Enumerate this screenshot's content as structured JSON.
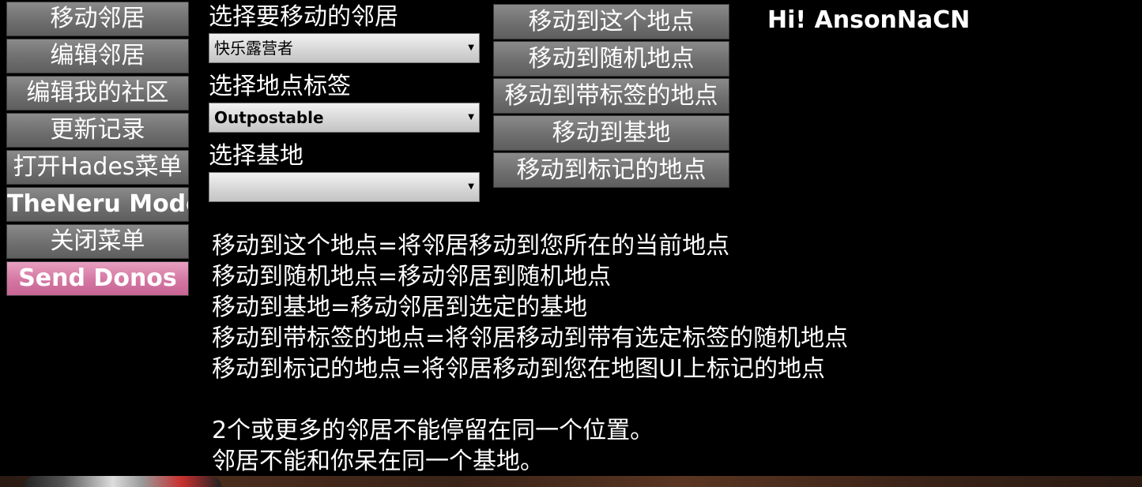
{
  "menu": {
    "items": [
      {
        "label": "移动邻居",
        "style": "normal"
      },
      {
        "label": "编辑邻居",
        "style": "normal"
      },
      {
        "label": "编辑我的社区",
        "style": "normal"
      },
      {
        "label": "更新记录",
        "style": "normal"
      },
      {
        "label": "打开Hades菜单",
        "style": "normal"
      },
      {
        "label": "TheNeru Mode",
        "style": "bold"
      },
      {
        "label": "关闭菜单",
        "style": "normal"
      },
      {
        "label": "Send Donos",
        "style": "pink"
      }
    ]
  },
  "selectors": {
    "neighbor_label": "选择要移动的邻居",
    "neighbor_value": "快乐露营者",
    "tag_label": "选择地点标签",
    "tag_value": "Outpostable",
    "base_label": "选择基地",
    "base_value": ""
  },
  "actions": {
    "items": [
      "移动到这个地点",
      "移动到随机地点",
      "移动到带标签的地点",
      "移动到基地",
      "移动到标记的地点"
    ]
  },
  "greeting": "Hi! AnsonNaCN",
  "description": {
    "lines": [
      "移动到这个地点=将邻居移动到您所在的当前地点",
      "移动到随机地点=移动邻居到随机地点",
      "移动到基地=移动邻居到选定的基地",
      "移动到带标签的地点=将邻居移动到带有选定标签的随机地点",
      "移动到标记的地点=将邻居移动到您在地图UI上标记的地点"
    ],
    "notes": [
      "2个或更多的邻居不能停留在同一个位置。",
      "邻居不能和你呆在同一个基地。"
    ]
  },
  "colors": {
    "background": "#000000",
    "button_gray": "#6f6f6f",
    "donate_pink": "#d274a0"
  }
}
